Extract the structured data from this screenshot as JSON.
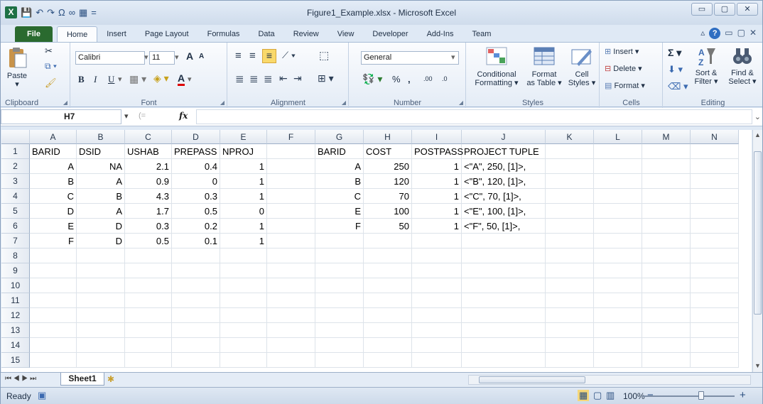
{
  "window": {
    "title": "Figure1_Example.xlsx  -  Microsoft Excel",
    "app_icon": "X",
    "controls": [
      "▭",
      "▢",
      "✕"
    ]
  },
  "qat": [
    "💾",
    "↶",
    "↷",
    "Ω",
    "∞",
    "▦",
    "="
  ],
  "tabs": [
    "File",
    "Home",
    "Insert",
    "Page Layout",
    "Formulas",
    "Data",
    "Review",
    "View",
    "Developer",
    "Add-Ins",
    "Team"
  ],
  "active_tab": "Home",
  "ribbon": {
    "clipboard": {
      "paste": "Paste",
      "label": "Clipboard"
    },
    "font": {
      "name": "Calibri",
      "size": "11",
      "bold": "B",
      "italic": "I",
      "underline": "U",
      "label": "Font",
      "grow": "A",
      "shrink": "A",
      "fontcolor": "A"
    },
    "alignment": {
      "label": "Alignment"
    },
    "number": {
      "format": "General",
      "percent": "%",
      "comma": ",",
      "inc": ".00",
      "dec": ".0",
      "label": "Number"
    },
    "styles": {
      "conditional": "Conditional",
      "conditional2": "Formatting ▾",
      "format_table": "Format",
      "format_table2": "as Table ▾",
      "cell_styles": "Cell",
      "cell_styles2": "Styles ▾",
      "label": "Styles"
    },
    "cells": {
      "insert": "Insert ▾",
      "delete": "Delete ▾",
      "format": "Format ▾",
      "label": "Cells"
    },
    "editing": {
      "sigma": "Σ ▾",
      "sort": "Sort &",
      "sort2": "Filter ▾",
      "find": "Find &",
      "find2": "Select ▾",
      "label": "Editing"
    }
  },
  "formula_bar": {
    "name_box": "H7",
    "fx": "fx",
    "value": ""
  },
  "columns": [
    "A",
    "B",
    "C",
    "D",
    "E",
    "F",
    "G",
    "H",
    "I",
    "J",
    "K",
    "L",
    "M",
    "N"
  ],
  "rows": [
    "1",
    "2",
    "3",
    "4",
    "5",
    "6",
    "7",
    "8",
    "9",
    "10",
    "11",
    "12",
    "13",
    "14",
    "15"
  ],
  "cells": {
    "row1": [
      "BARID",
      "DSID",
      "USHAB",
      "PREPASS",
      "NPROJ",
      "",
      "BARID",
      "COST",
      "POSTPASS",
      "PROJECT TUPLE"
    ],
    "row2": [
      "A",
      "NA",
      "2.1",
      "0.4",
      "1",
      "",
      "A",
      "250",
      "1",
      "<\"A\", 250, [1]>,"
    ],
    "row3": [
      "B",
      "A",
      "0.9",
      "0",
      "1",
      "",
      "B",
      "120",
      "1",
      "<\"B\", 120, [1]>,"
    ],
    "row4": [
      "C",
      "B",
      "4.3",
      "0.3",
      "1",
      "",
      "C",
      "70",
      "1",
      "<\"C\", 70, [1]>,"
    ],
    "row5": [
      "D",
      "A",
      "1.7",
      "0.5",
      "0",
      "",
      "E",
      "100",
      "1",
      "<\"E\", 100, [1]>,"
    ],
    "row6": [
      "E",
      "D",
      "0.3",
      "0.2",
      "1",
      "",
      "F",
      "50",
      "1",
      "<\"F\", 50, [1]>,"
    ],
    "row7": [
      "F",
      "D",
      "0.5",
      "0.1",
      "1",
      "",
      "",
      "",
      "",
      ""
    ]
  },
  "sheet_tabs": [
    "Sheet1"
  ],
  "status": {
    "ready": "Ready",
    "zoom": "100%",
    "minus": "−",
    "plus": "+"
  }
}
